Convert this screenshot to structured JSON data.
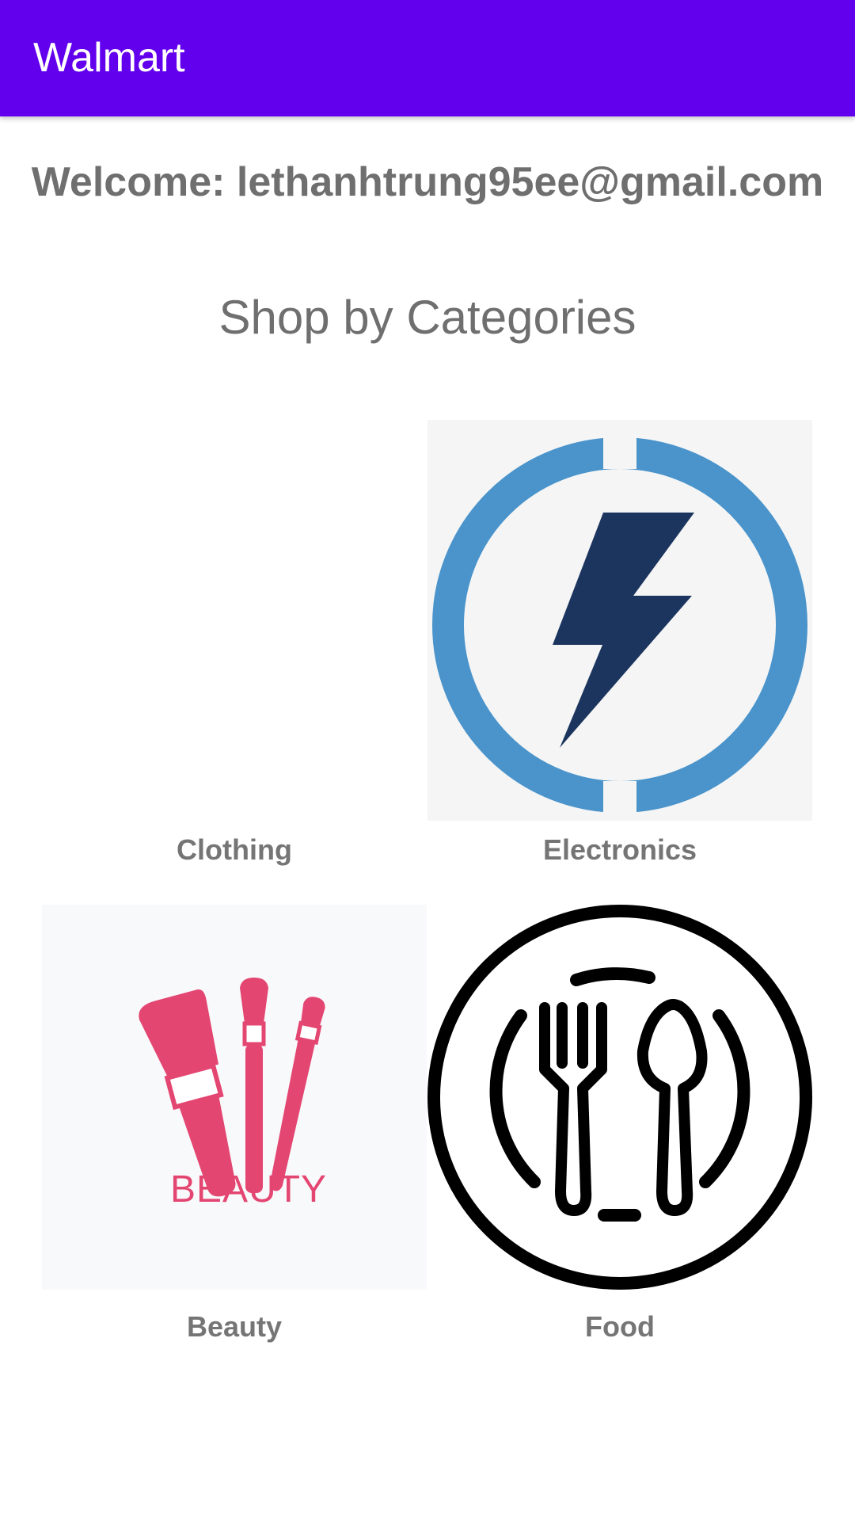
{
  "app_bar": {
    "title": "Walmart",
    "color": "#6200ee"
  },
  "welcome_text": "Welcome: lethanhtrung95ee@gmail.com",
  "section_title": "Shop by Categories",
  "categories": [
    {
      "label": "Clothing",
      "icon": "clothing-image"
    },
    {
      "label": "Electronics",
      "icon": "lightning-bolt-icon",
      "colors": {
        "ring": "#4a94cb",
        "bolt": "#1c355e",
        "background": "#f5f5f5"
      }
    },
    {
      "label": "Beauty",
      "icon": "makeup-brushes-icon",
      "logo_text": "BEAUTY",
      "colors": {
        "brush": "#e44672",
        "background": "#f8f9fb"
      }
    },
    {
      "label": "Food",
      "icon": "fork-spoon-plate-icon",
      "colors": {
        "stroke": "#000000"
      }
    }
  ]
}
